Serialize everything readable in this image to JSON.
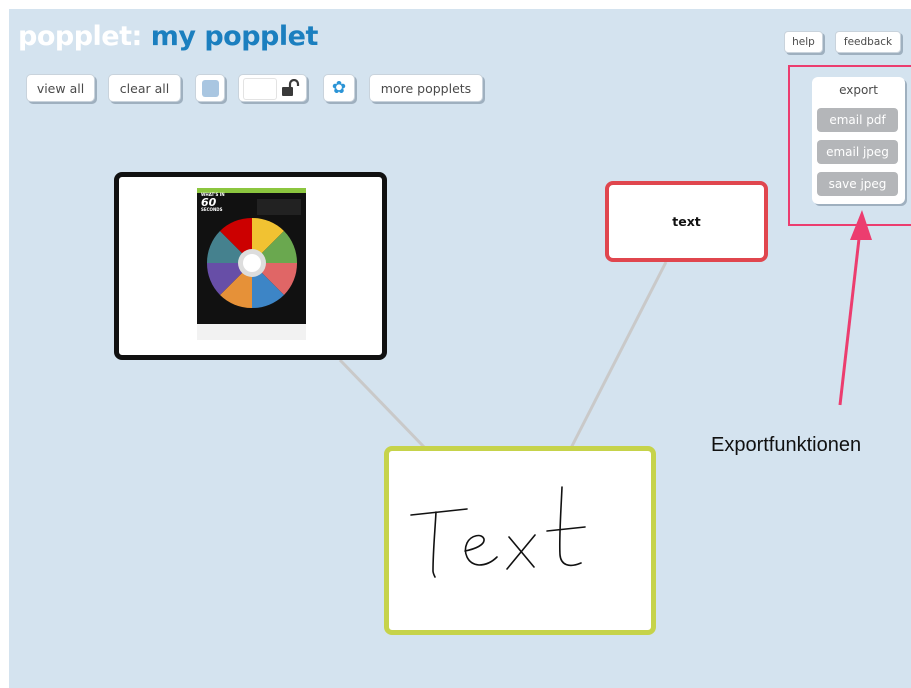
{
  "app": {
    "brand": "popplet:",
    "board_title": "my popplet"
  },
  "toolbar": {
    "view_all": "view all",
    "clear_all": "clear all",
    "color_swatch": "#a9c6e1",
    "lock_icon": "unlocked-padlock-icon",
    "settings_icon": "gear-icon",
    "more_popplets": "more popplets"
  },
  "top_right": {
    "help": "help",
    "feedback": "feedback"
  },
  "export": {
    "title": "export",
    "items": [
      {
        "label": "email pdf"
      },
      {
        "label": "email jpeg"
      },
      {
        "label": "save jpeg"
      }
    ]
  },
  "nodes": {
    "image_node": {
      "border": "#111111"
    },
    "text_node": {
      "label": "text",
      "border": "#e0464e"
    },
    "drawing_node": {
      "handwriting": "Text",
      "border": "#c6d34a"
    }
  },
  "infographic": {
    "heading_line1": "WHAT'S IN",
    "heading_number": "60",
    "heading_line2": "SECONDS"
  },
  "annotation": {
    "label": "Exportfunktionen",
    "color": "#ec3d6f"
  },
  "colors": {
    "background": "#d4e3ef",
    "accent": "#1b7fbf",
    "connector": "#c9c9c9"
  }
}
